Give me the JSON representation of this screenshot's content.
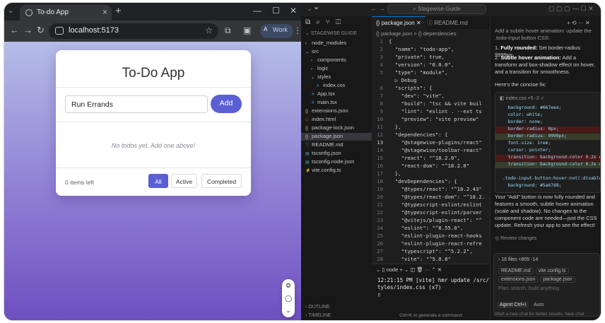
{
  "browser": {
    "tab_title": "To-do App",
    "url": "localhost:5173",
    "profile_label": "Work"
  },
  "app": {
    "title": "To-Do App",
    "input_value": "Run Errands",
    "add_label": "Add",
    "empty_message": "No todos yet. Add one above!",
    "items_left": "0 items left",
    "filters": [
      "All",
      "Active",
      "Completed"
    ],
    "active_filter": "All",
    "accent_color": "#5a5fd4"
  },
  "editor": {
    "command_center": "Stagewise Guide",
    "explorer_heading": "STAGEWISE GUIDE",
    "tree": [
      {
        "label": "node_modules",
        "kind": "folder"
      },
      {
        "label": "src",
        "kind": "folder"
      },
      {
        "label": "components",
        "kind": "folder"
      },
      {
        "label": "logic",
        "kind": "folder"
      },
      {
        "label": "styles",
        "kind": "folder"
      },
      {
        "label": "index.css",
        "kind": "file"
      },
      {
        "label": "App.tsx",
        "kind": "file"
      },
      {
        "label": "main.tsx",
        "kind": "file"
      },
      {
        "label": "extensions.json",
        "kind": "file"
      },
      {
        "label": "index.html",
        "kind": "file"
      },
      {
        "label": "package-lock.json",
        "kind": "file"
      },
      {
        "label": "package.json",
        "kind": "file"
      },
      {
        "label": "README.md",
        "kind": "file"
      },
      {
        "label": "tsconfig.json",
        "kind": "file"
      },
      {
        "label": "tsconfig.node.json",
        "kind": "file"
      },
      {
        "label": "vite.config.ts",
        "kind": "file"
      }
    ],
    "outline_label": "OUTLINE",
    "timeline_label": "TIMELINE",
    "tabs": [
      "package.json",
      "README.md"
    ],
    "breadcrumb": "{} package.json > {} dependencies",
    "code_lines": [
      {
        "n": "1",
        "t": "{"
      },
      {
        "n": "2",
        "t": "  \"name\": \"todo-app\","
      },
      {
        "n": "3",
        "t": "  \"private\": true,"
      },
      {
        "n": "4",
        "t": "  \"version\": \"0.0.0\","
      },
      {
        "n": "5",
        "t": "  \"type\": \"module\","
      },
      {
        "n": "",
        "t": "  ▷ Debug"
      },
      {
        "n": "6",
        "t": "  \"scripts\": {"
      },
      {
        "n": "7",
        "t": "    \"dev\": \"vite\","
      },
      {
        "n": "8",
        "t": "    \"build\": \"tsc && vite buil"
      },
      {
        "n": "9",
        "t": "    \"lint\": \"eslint . --ext ts"
      },
      {
        "n": "10",
        "t": "    \"preview\": \"vite preview\""
      },
      {
        "n": "11",
        "t": "  },"
      },
      {
        "n": "12",
        "t": "  \"dependencies\": {"
      },
      {
        "n": "13",
        "t": "    \"@stagewise-plugins/react\""
      },
      {
        "n": "14",
        "t": "    \"@stagewise/toolbar-react\""
      },
      {
        "n": "15",
        "t": "    \"react\": \"^18.2.0\","
      },
      {
        "n": "16",
        "t": "    \"react-dom\": \"^18.2.0\""
      },
      {
        "n": "17",
        "t": "  },"
      },
      {
        "n": "18",
        "t": "  \"devDependencies\": {"
      },
      {
        "n": "19",
        "t": "    \"@types/react\": \"^18.2.43\""
      },
      {
        "n": "20",
        "t": "    \"@types/react-dom\": \"^18.2."
      },
      {
        "n": "21",
        "t": "    \"@typescript-eslint/eslint"
      },
      {
        "n": "22",
        "t": "    \"@typescript-eslint/parser"
      },
      {
        "n": "23",
        "t": "    \"@vitejs/plugin-react\": \"^"
      },
      {
        "n": "24",
        "t": "    \"eslint\": \"^8.55.0\","
      },
      {
        "n": "25",
        "t": "    \"eslint-plugin-react-hooks"
      },
      {
        "n": "26",
        "t": "    \"eslint-plugin-react-refre"
      },
      {
        "n": "27",
        "t": "    \"typescript\": \"^5.2.2\","
      },
      {
        "n": "28",
        "t": "    \"vite\": \"^5.0.8\""
      },
      {
        "n": "29",
        "t": "  }"
      },
      {
        "n": "30",
        "t": "}"
      }
    ],
    "current_line": "13",
    "terminal": {
      "label": "node",
      "output": "12:21:15 PM [vite] hmr update /src/s\ntyles/index.css (x7)\n▯",
      "hint": "Ctrl+K to generate a command"
    }
  },
  "chat": {
    "header_glyphs": "+ ⟲ ··· ✕",
    "intro": "Add a subtle hover animation: update the .todo-input button CSS:",
    "points": [
      {
        "bold": "Fully rounded:",
        "text": " Set border-radius: 9999px;"
      },
      {
        "bold": "Subtle hover animation:",
        "text": " Add a transform and box-shadow effect on hover, and a transition for smoothness."
      }
    ],
    "concise_fix": "Here's the concise fix:",
    "diff_file": "index.css +5 -2 ✓",
    "diff_lines": [
      {
        "t": "  background: #667eea;",
        "kind": "ctx"
      },
      {
        "t": "  color: white;",
        "kind": "ctx"
      },
      {
        "t": "  border: none;",
        "kind": "ctx"
      },
      {
        "t": "  border-radius: 8px;",
        "kind": "del"
      },
      {
        "t": "  border-radius: 9999px;",
        "kind": "add"
      },
      {
        "t": "  font-size: 1rem;",
        "kind": "ctx"
      },
      {
        "t": "  cursor: pointer;",
        "kind": "ctx"
      },
      {
        "t": "  transition: background-color 0.2s ease",
        "kind": "del"
      },
      {
        "t": "  transition: background-color 0.2s ease",
        "kind": "add"
      },
      {
        "t": "",
        "kind": "ctx"
      },
      {
        "t": ".todo-input-button:hover:not(:disabled)",
        "kind": "ctx"
      },
      {
        "t": "  background: #5a67d8;",
        "kind": "ctx"
      }
    ],
    "summary": "Your \"Add\" button is now fully rounded and features a smooth, subtle hover animation (scale and shadow). No changes to the component code are needed—just the CSS update. Refresh your app to see the effect!",
    "review": "Review changes",
    "files_count": "16 files +805 -14",
    "chips": [
      "README.md",
      "vite.config.ts",
      "extensions.json",
      "package.json"
    ],
    "placeholder": "Plan, search, build anything",
    "agent_label": "Agent Ctrl+I",
    "auto_label": "Auto",
    "new_chat": "Start a new chat for better results. New chat"
  }
}
